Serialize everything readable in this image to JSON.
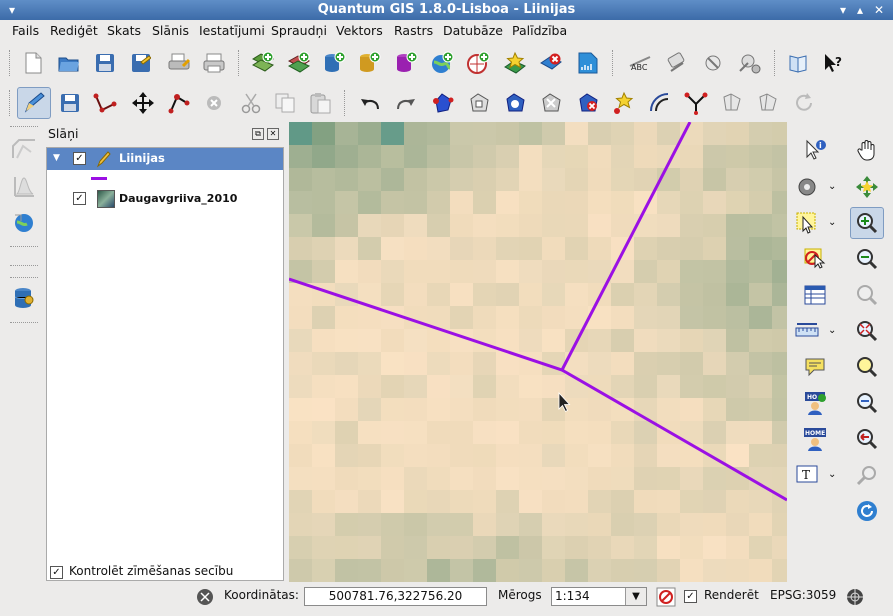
{
  "window": {
    "title": "Quantum GIS 1.8.0-Lisboa - Liinijas"
  },
  "menu": [
    "Fails",
    "Rediģēt",
    "Skats",
    "Slānis",
    "Iestatījumi",
    "Spraudņi",
    "Vektors",
    "Rastrs",
    "Datubāze",
    "Palīdzība"
  ],
  "layers_panel": {
    "title": "Slāņi",
    "layers": [
      {
        "name": "Liinijas",
        "checked": true,
        "type": "line",
        "symbol_color": "#9b10e4",
        "selected": true
      },
      {
        "name": "Daugavgriiva_2010",
        "checked": true,
        "type": "raster",
        "selected": false
      }
    ],
    "render_order_label": "Kontrolēt zīmēšanas secību",
    "render_order_checked": true
  },
  "map": {
    "line_color": "#9b10e4"
  },
  "status": {
    "coordinates_label": "Koordinātas:",
    "coordinates_value": "500781.76,322756.20",
    "scale_label": "Mērogs",
    "scale_value": "1:134",
    "render_label": "Renderēt",
    "render_checked": true,
    "crs": "EPSG:3059"
  }
}
